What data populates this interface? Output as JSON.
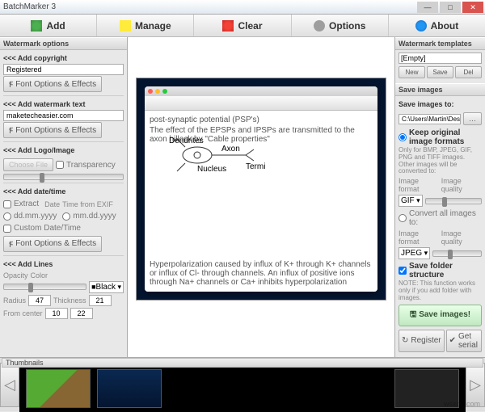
{
  "app": {
    "title": "BatchMarker 3"
  },
  "toolbar": {
    "add": "Add",
    "manage": "Manage",
    "clear": "Clear",
    "options": "Options",
    "about": "About"
  },
  "left": {
    "panel_title": "Watermark options",
    "copyright_hdr": "<<< Add copyright",
    "registered": "Registered",
    "font_btn": "Font Options & Effects",
    "text_hdr": "<<< Add watermark text",
    "text_value": "maketecheasier.com",
    "logo_hdr": "<<< Add Logo/Image",
    "choose_file": "Choose File",
    "transparency": "Transparency",
    "date_hdr": "<<< Add date/time",
    "extract": "Extract",
    "date": "Date",
    "time_exif": "Time from EXIF",
    "dmy": "dd.mm.yyyy",
    "mdy": "mm.dd.yyyy",
    "custom_dt": "Custom Date/Time",
    "lines_hdr": "<<< Add Lines",
    "color_lbl": "Color",
    "opacity_lbl": "Opacity",
    "black": "Black",
    "radius_lbl": "Radius",
    "thick_lbl": "Thickness",
    "center_lbl": "From center",
    "r_v": "47",
    "t_v": "21",
    "c1": "10",
    "c2": "22"
  },
  "right": {
    "tmpl_title": "Watermark templates",
    "empty": "[Empty]",
    "new": "New",
    "save": "Save",
    "del": "Del",
    "save_hdr": "Save images",
    "save_to": "Save images to:",
    "path": "C:\\Users\\Martin\\Desktop\\Images",
    "keep": "Keep original image formats",
    "keep_note": "Only for BMP, JPEG, GIF, PNG and TIFF images. Other images will be converted to:",
    "imgfmt": "Image format",
    "imgqual": "Image quality",
    "gif": "GIF",
    "convert_all": "Convert all images to:",
    "jpeg": "JPEG",
    "save_folder": "Save folder structure",
    "note": "NOTE: This function works only if you add folder with images.",
    "save_btn": "Save images!",
    "register": "Register",
    "get_serial": "Get serial"
  },
  "thumbs": {
    "title": "Thumbnails"
  },
  "watermark_site": "wsxdn.com"
}
